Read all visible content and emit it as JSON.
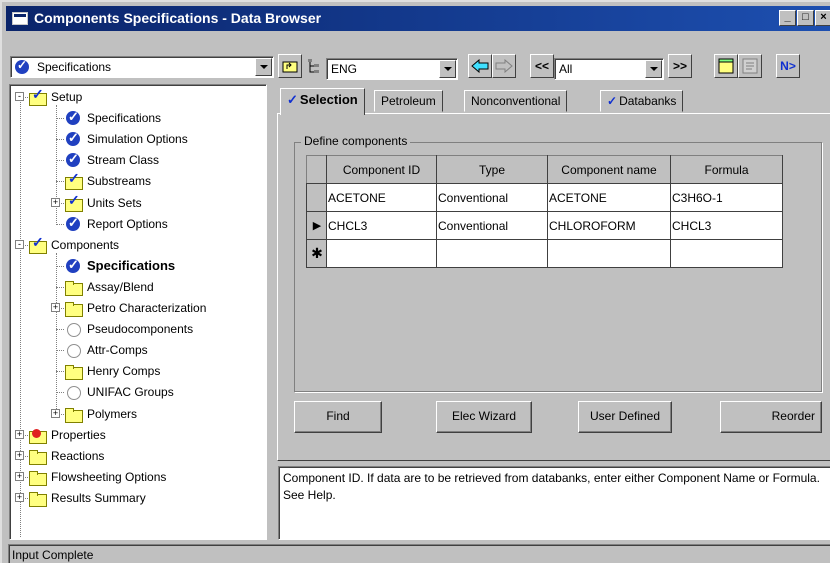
{
  "window": {
    "title": "Components Specifications - Data Browser"
  },
  "title_buttons": {
    "minimize": "_",
    "maximize": "□",
    "close": "×"
  },
  "toolbar": {
    "form_combo_value": "Specifications",
    "units_combo_value": "ENG",
    "filter_combo_value": "All",
    "prev_prev_label": "<<",
    "next_next_label": ">>",
    "next_label": "N>"
  },
  "tree": {
    "items": [
      {
        "label": "Setup",
        "icon": "folder-check-icon"
      },
      {
        "label": "Specifications",
        "icon": "check-circle-icon"
      },
      {
        "label": "Simulation Options",
        "icon": "check-circle-icon"
      },
      {
        "label": "Stream Class",
        "icon": "check-circle-icon"
      },
      {
        "label": "Substreams",
        "icon": "folder-check-icon"
      },
      {
        "label": "Units Sets",
        "icon": "folder-check-icon"
      },
      {
        "label": "Report Options",
        "icon": "check-circle-icon"
      },
      {
        "label": "Components",
        "icon": "folder-check-icon"
      },
      {
        "label": "Specifications",
        "icon": "check-circle-icon"
      },
      {
        "label": "Assay/Blend",
        "icon": "folder-icon"
      },
      {
        "label": "Petro Characterization",
        "icon": "folder-icon"
      },
      {
        "label": "Pseudocomponents",
        "icon": "empty-circle-icon"
      },
      {
        "label": "Attr-Comps",
        "icon": "empty-circle-icon"
      },
      {
        "label": "Henry Comps",
        "icon": "folder-icon"
      },
      {
        "label": "UNIFAC Groups",
        "icon": "empty-circle-icon"
      },
      {
        "label": "Polymers",
        "icon": "folder-icon"
      },
      {
        "label": "Properties",
        "icon": "folder-error-icon"
      },
      {
        "label": "Reactions",
        "icon": "folder-icon"
      },
      {
        "label": "Flowsheeting Options",
        "icon": "folder-icon"
      },
      {
        "label": "Results Summary",
        "icon": "folder-icon"
      }
    ]
  },
  "tabs": [
    {
      "label": "Selection",
      "checked": true,
      "active": true
    },
    {
      "label": "Petroleum",
      "checked": false,
      "active": false
    },
    {
      "label": "Nonconventional",
      "checked": false,
      "active": false
    },
    {
      "label": "Databanks",
      "checked": true,
      "active": false
    }
  ],
  "group": {
    "title": "Define components"
  },
  "grid": {
    "columns": [
      "Component ID",
      "Type",
      "Component name",
      "Formula"
    ],
    "rows": [
      {
        "marker": "",
        "cells": [
          "ACETONE",
          "Conventional",
          "ACETONE",
          "C3H6O-1"
        ]
      },
      {
        "marker": "▶",
        "cells": [
          "CHCL3",
          "Conventional",
          "CHLOROFORM",
          "CHCL3"
        ]
      },
      {
        "marker": "✱",
        "cells": [
          "",
          "",
          "",
          ""
        ]
      }
    ]
  },
  "buttons": {
    "find": "Find",
    "elec_wizard": "Elec Wizard",
    "user_defined": "User Defined",
    "reorder": "Reorder"
  },
  "help_text": "Component ID. If data are to be retrieved from databanks, enter either Component Name or Formula. See Help.",
  "status": {
    "text": "Input Complete"
  }
}
